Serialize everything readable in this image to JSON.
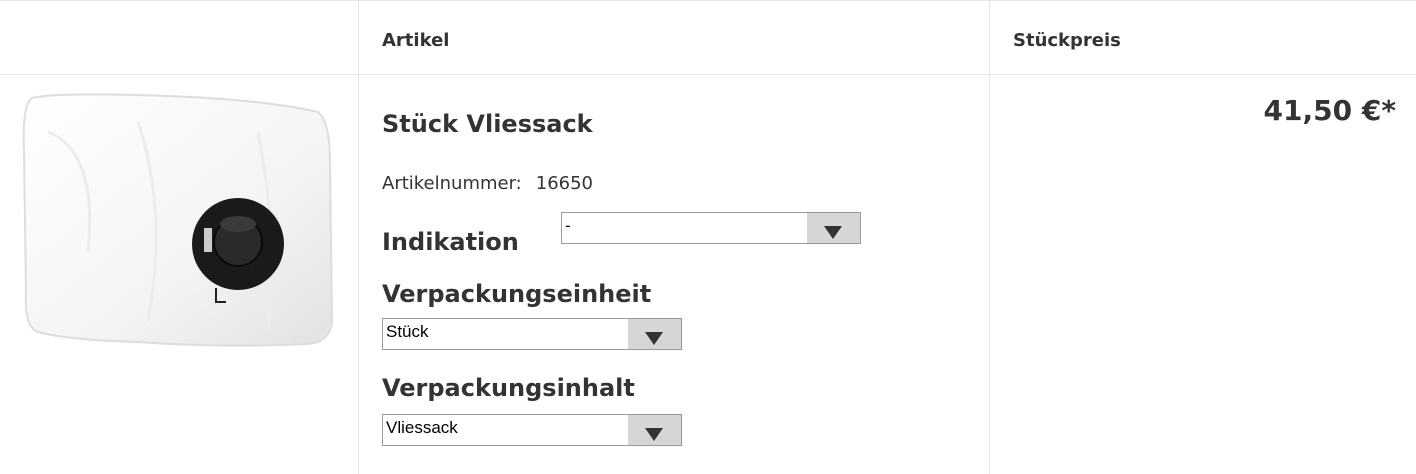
{
  "table": {
    "headers": {
      "image": "",
      "article": "Artikel",
      "unit_price": "Stückpreis"
    }
  },
  "product": {
    "image_alt": "Vliessack",
    "name": "Stück Vliessack",
    "article_number_label": "Artikelnummer:",
    "article_number": "16650",
    "options": {
      "indikation": {
        "label": "Indikation",
        "selected": "-"
      },
      "verpackungseinheit": {
        "label": "Verpackungseinheit",
        "selected": "Stück"
      },
      "verpackungsinhalt": {
        "label": "Verpackungsinhalt",
        "selected": "Vliessack"
      }
    },
    "price": "41,50 €*"
  }
}
